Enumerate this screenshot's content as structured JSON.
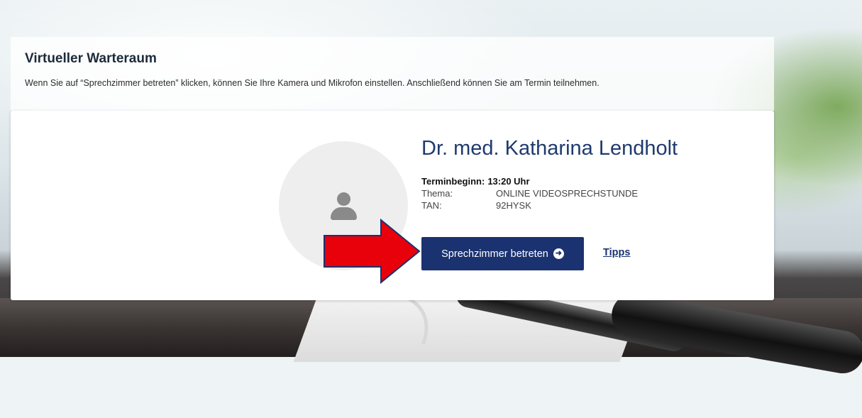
{
  "header": {
    "title": "Virtueller Warteraum",
    "description": "Wenn Sie auf “Sprechzimmer betreten” klicken, können Sie Ihre Kamera und Mikrofon einstellen. Anschließend können Sie am Termin teilnehmen."
  },
  "appointment": {
    "doctor_name": "Dr. med. Katharina Lendholt",
    "start_label": "Terminbeginn:",
    "start_value": "13:20 Uhr",
    "topic_label": "Thema:",
    "topic_value": "ONLINE VIDEOSPRECHSTUNDE",
    "tan_label": "TAN:",
    "tan_value": "92HYSK"
  },
  "actions": {
    "enter_label": "Sprechzimmer betreten",
    "enter_icon": "arrow-right-circle-icon",
    "tips_label": "Tipps"
  },
  "colors": {
    "primary": "#1b3270",
    "annotation_arrow": "#e8000b"
  }
}
